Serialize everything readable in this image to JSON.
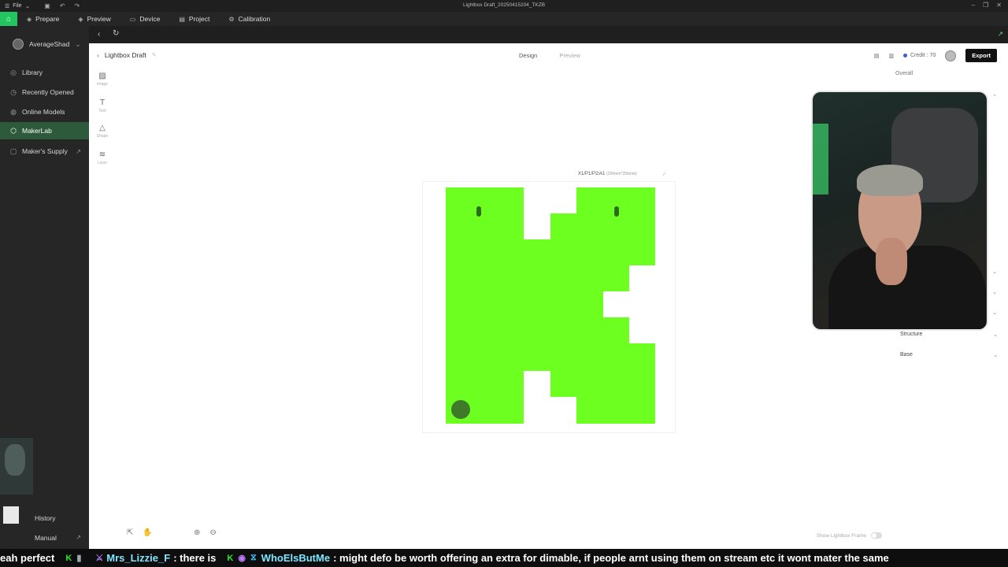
{
  "window": {
    "menu_label": "File",
    "title": "Lightbox Draft_20250415204_TKZB"
  },
  "topnav": {
    "items": [
      {
        "label": "Prepare"
      },
      {
        "label": "Preview"
      },
      {
        "label": "Device"
      },
      {
        "label": "Project"
      },
      {
        "label": "Calibration"
      }
    ]
  },
  "sidebar": {
    "user_name": "AverageShad",
    "items": [
      {
        "label": "Library"
      },
      {
        "label": "Recently Opened"
      },
      {
        "label": "Online Models"
      },
      {
        "label": "MakerLab"
      },
      {
        "label": "Maker's Supply"
      }
    ],
    "history_label": "History",
    "manual_label": "Manual"
  },
  "editor": {
    "project_title": "Lightbox Draft",
    "mode_tabs": [
      {
        "label": "Design"
      },
      {
        "label": "Preview"
      }
    ],
    "credit_label": "Credit : 70",
    "export_label": "Export",
    "tools": [
      {
        "label": "Image"
      },
      {
        "label": "Text"
      },
      {
        "label": "Shape"
      },
      {
        "label": "Layer"
      }
    ],
    "printer_label": "X1/P1/P2/A1",
    "bed_size": "(256mm*256mm)",
    "show_frame_label": "Show Lightbox Frame"
  },
  "panel": {
    "title": "Overall",
    "sections": [
      {
        "label": "Structure"
      },
      {
        "label": "Base"
      }
    ]
  },
  "ticker": {
    "seg1_text": "eah perfect",
    "user1": "Mrs_Lizzie_F",
    "msg1": ": there is",
    "user2": "WhoElsButMe",
    "msg2": ": might defo be worth offering an extra for dimable, if people arnt using them on stream etc it wont mater the same"
  },
  "colors": {
    "accent": "#23c55e",
    "board_fill": "#6dff1f",
    "active_sidebar": "#2d5a3a"
  }
}
